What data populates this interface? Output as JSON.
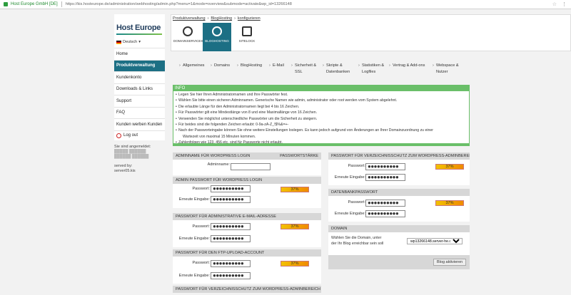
{
  "browser": {
    "site": "Host Europe GmbH [DE]",
    "url": "https://kis.hosteurope.de/administration/webhosting/admin.php?menu=1&mode=overview&submode=activate&wp_id=13266148"
  },
  "logo": "Host Europe",
  "language": "Deutsch",
  "nav": [
    "Home",
    "Produktverwaltung",
    "Kundenkonto",
    "Downloads & Links",
    "Support",
    "FAQ",
    "Kunden werben Kunden",
    "Log out"
  ],
  "sidebar_info": {
    "logged_in": "Sie sind angemeldet:",
    "blur1": "█████ ██████",
    "blur2": "██████ ██████",
    "served": "served by:",
    "server": "server05.kis"
  },
  "breadcrumb": [
    "Produktverwaltung",
    "BlogHosting",
    "konfigurieren"
  ],
  "product_tabs": [
    "DOMAINSERVICES",
    "BLOGHOSTING",
    "SITELOCK"
  ],
  "sub_tabs": [
    "Allgemeines",
    "Domains",
    "BlogHosting",
    "E-Mail",
    "Sicherheit & SSL",
    "Skripte & Datenbanken",
    "Statistiken & Logfiles",
    "Vertrag & Add-ons",
    "Webspace & Nutzer"
  ],
  "info": {
    "title": "INFO",
    "items": [
      "Legen Sie hier Ihren Administratornamen und Ihre Passwörter fest.",
      "Wählen Sie bitte einen sicheren Adminnamen. Generische Namen wie admin, administrator oder root werden vom System abgelehnt.",
      "Die erlaubte Länge für den Administratornamen liegt bei 4 bis 16 Zeichen.",
      "Für Passwörter gilt eine Mindestlänge von 8 und eine Maximallänge von 16 Zeichen.",
      "Verwenden Sie möglichst unterschiedliche Passwörter um die Sicherheit zu steigern.",
      "Für beides sind die folgenden Zeichen erlaubt: 0-9a-zA-Z_!$%&=+-",
      "Nach der Passworteingabe können Sie ohne weitere Einstellungen loslegen. Es kann jedoch aufgrund von Änderungen an Ihrer Domainzuordnung zu einer",
      "Wartezeit von maximal 15 Minuten kommen.",
      "Zahlenfolgen wie 123, 456 etc. sind für Passworte nicht erlaubt."
    ]
  },
  "labels": {
    "password": "Passwort:",
    "repeat": "Erneute Eingabe:",
    "strength": "37%",
    "admin_name": "Adminname:",
    "dots": "●●●●●●●●●●"
  },
  "sections": {
    "adminname_header": "ADMINNAME FÜR WORDPRESS LOGIN",
    "pw_strength_header": "PASSWORTSTÄRKE",
    "admin_pw_header": "ADMIN PASSWORT FÜR WORDPRESS LOGIN",
    "email_pw_header": "PASSWORT FÜR ADMINISTRATIVE E-MAIL-ADRESSE",
    "ftp_pw_header": "PASSWORT FÜR DEN FTP-UPLOAD-ACCOUNT",
    "dir_pw_header_bottom": "PASSWORT FÜR VERZEICHNISSCHUTZ ZUM WORDPRESS-ADMINBEREICH",
    "dir_pw_header": "PASSWORT FÜR VERZEICHNISSCHUTZ ZUM WORDPRESS-ADMINBEREICH",
    "db_pw_header": "DATENBANKPASSWORT",
    "domain_header": "DOMAIN",
    "domain_label_1": "Wählen Sie die Domain, unter",
    "domain_label_2": "der Ihr Blog erreichbar sein soll",
    "domain_value": "wp13266148.server-he.de",
    "activate_button": "Blog aktivieren"
  }
}
